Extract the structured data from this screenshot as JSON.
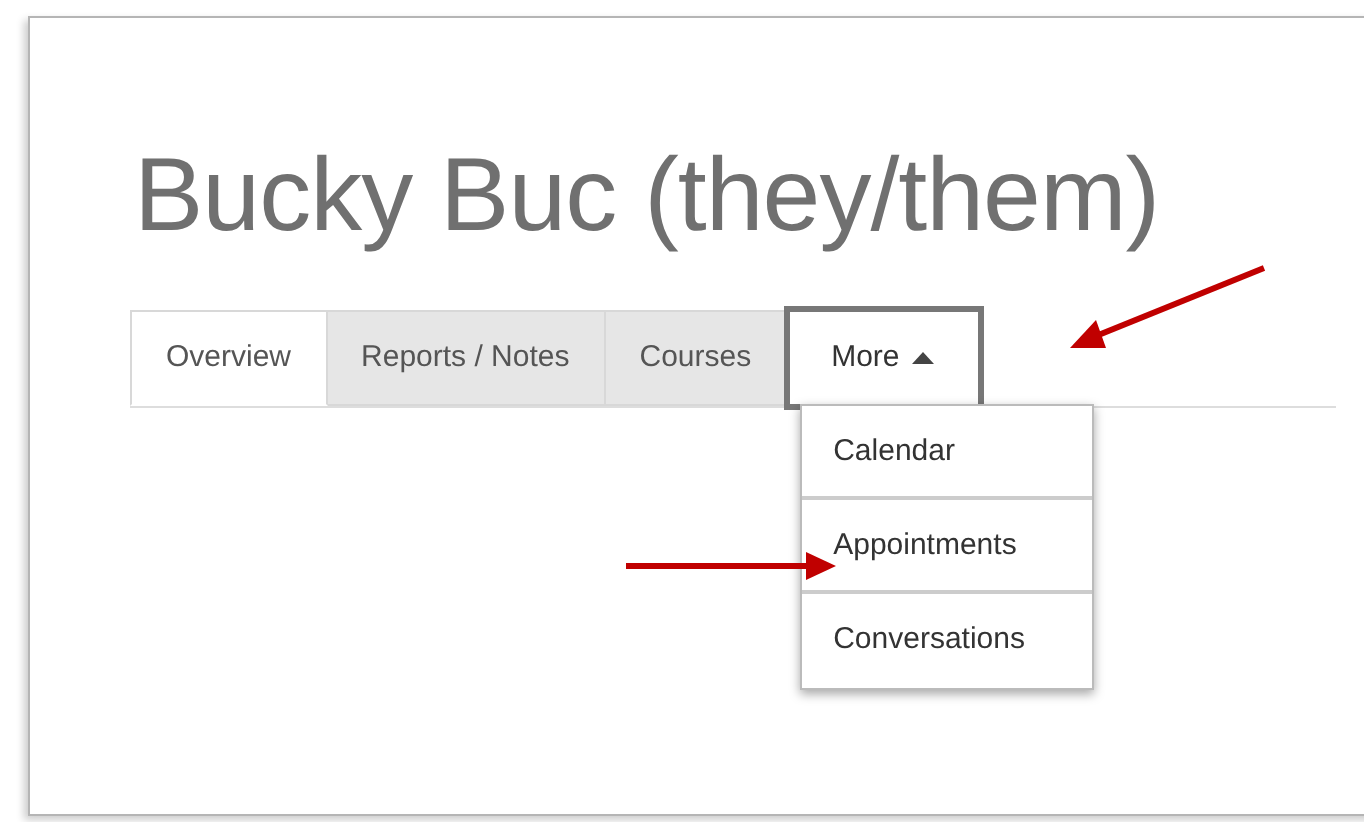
{
  "heading": "Bucky Buc (they/them)",
  "tabs": [
    {
      "label": "Overview",
      "selected": true
    },
    {
      "label": "Reports / Notes",
      "selected": false
    },
    {
      "label": "Courses",
      "selected": false
    },
    {
      "label": "More",
      "selected": false,
      "kind": "dropdown",
      "expanded": true,
      "highlighted": true
    }
  ],
  "dropdown_items": [
    "Calendar",
    "Appointments",
    "Conversations"
  ]
}
